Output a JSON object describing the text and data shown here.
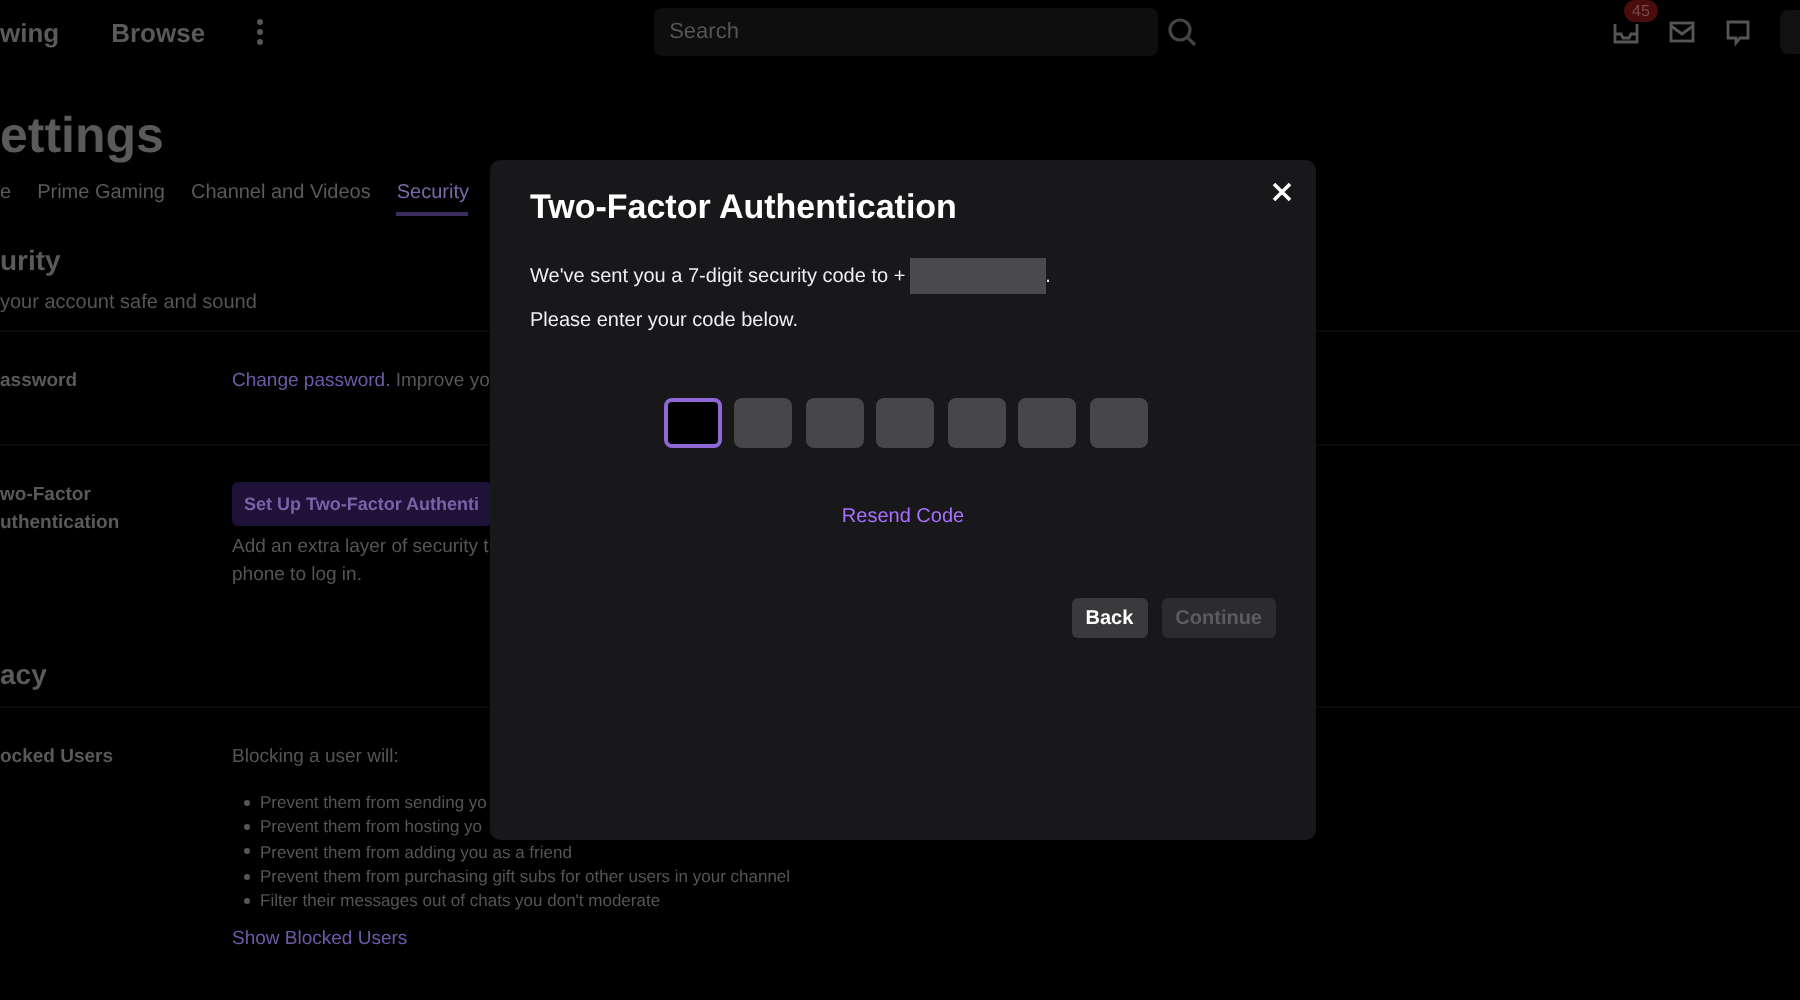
{
  "top_nav": {
    "links": [
      "wing",
      "Browse"
    ],
    "search": {
      "placeholder": "Search"
    },
    "notification_badge": "45"
  },
  "page": {
    "title": "ettings",
    "tabs": [
      {
        "label": "e",
        "selected": false
      },
      {
        "label": "Prime Gaming",
        "selected": false
      },
      {
        "label": "Channel and Videos",
        "selected": false
      },
      {
        "label": "Security",
        "selected": true
      }
    ],
    "sections": [
      {
        "heading": "urity",
        "subtitle": "your account safe and sound",
        "rows": [
          {
            "kind": "link",
            "label": "assword",
            "link": "Change password.",
            "text": " Improve yo"
          },
          {
            "kind": "button",
            "label": "wo-Factor uthentication",
            "button": "Set Up Two-Factor Authenti",
            "text": "Add an extra layer of security t\nphone to log in."
          }
        ]
      },
      {
        "heading": "acy",
        "rows": [
          {
            "kind": "list",
            "label": "ocked Users",
            "text": "Blocking a user will:",
            "items": [
              "Prevent them from sending yo",
              "Prevent them from hosting yo",
              "Prevent them from adding you as a friend",
              "Prevent them from purchasing gift subs for other users in your channel",
              "Filter their messages out of chats you don't moderate"
            ],
            "link": "Show Blocked Users"
          }
        ]
      }
    ]
  },
  "modal": {
    "title": "Two-Factor Authentication",
    "message": "We've sent you a 7-digit security code to +",
    "message_end": ".",
    "instruction": "Please enter your code below.",
    "code_inputs": [
      {
        "selected": true
      },
      {
        "selected": false
      },
      {
        "selected": false
      },
      {
        "selected": false
      },
      {
        "selected": false
      },
      {
        "selected": false
      },
      {
        "selected": false
      }
    ],
    "resend": "Resend Code",
    "buttons": [
      {
        "label": "Back",
        "disabled": false
      },
      {
        "label": "Continue",
        "disabled": true
      }
    ]
  }
}
